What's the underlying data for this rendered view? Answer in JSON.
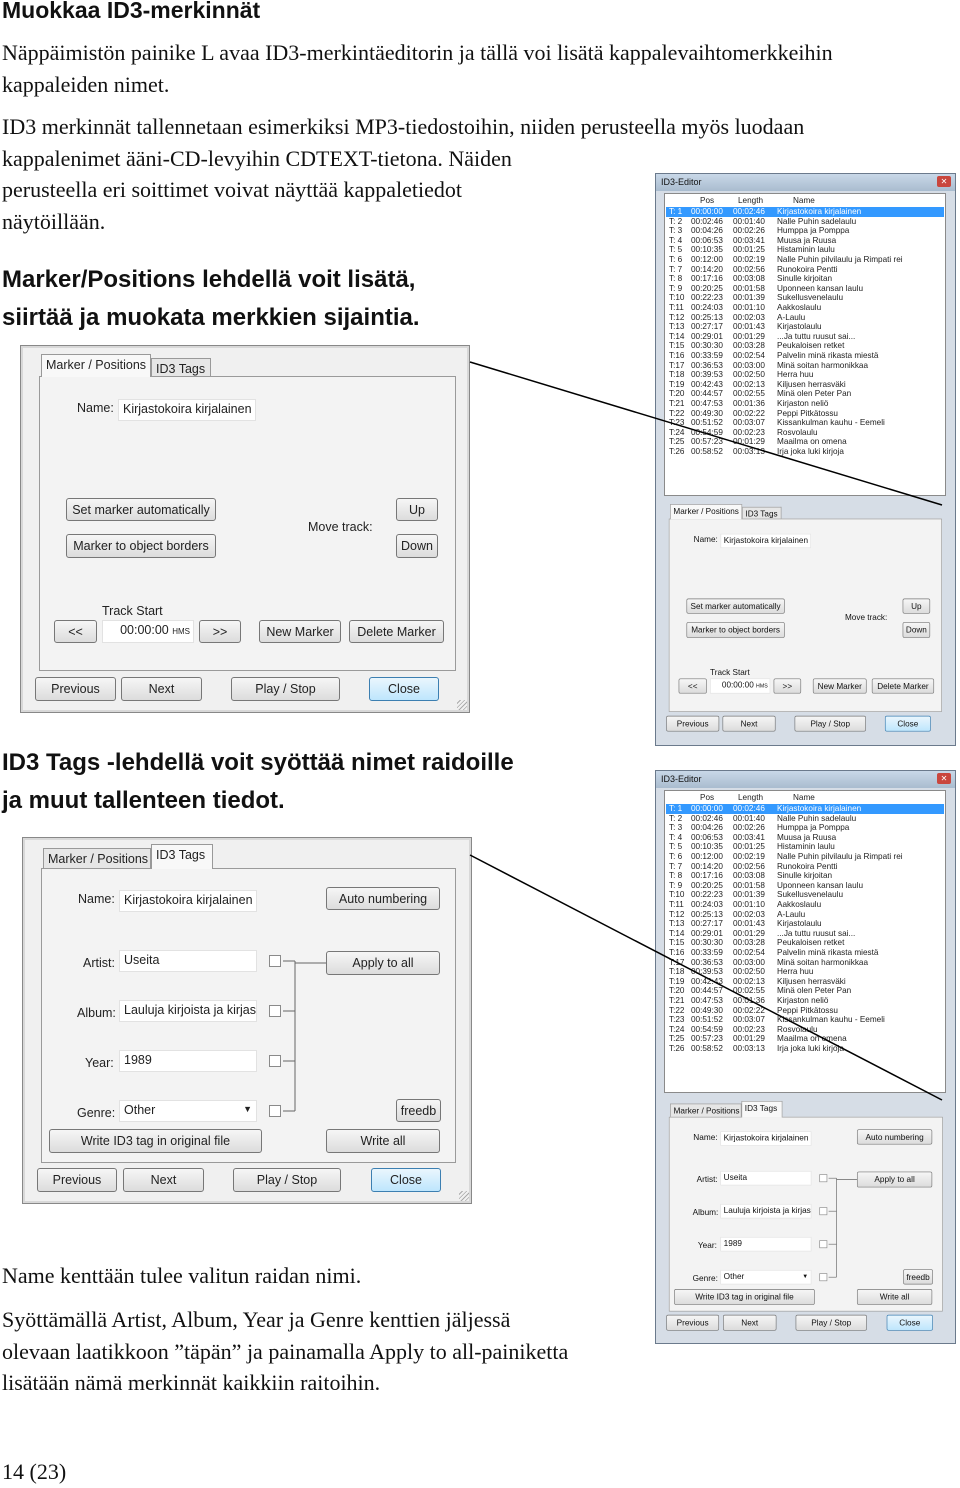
{
  "title": "Muokkaa ID3-merkinnät",
  "para1": [
    "Näppäimistön painike L avaa ID3-merkintäeditorin ja tällä voi lisätä kappalevaihtomerkkeihin",
    "kappaleiden nimet."
  ],
  "para2": [
    "ID3 merkinnät tallennetaan esimerkiksi MP3-tiedostoihin, niiden perusteella myös luodaan",
    "kappalenimet ääni-CD-levyihin CDTEXT-tietona. Näiden",
    "perusteella eri soittimet voivat näyttää kappaletiedot",
    "näytöillään."
  ],
  "heading_marker": [
    "Marker/Positions lehdellä voit lisätä,",
    "siirtää ja muokata merkkien sijaintia."
  ],
  "heading_id3": [
    "ID3 Tags -lehdellä voit syöttää nimet raidoille",
    "ja muut tallenteen tiedot."
  ],
  "para3": "Name kenttään tulee valitun raidan nimi.",
  "para4": [
    "Syöttämällä Artist, Album, Year ja Genre kenttien jäljessä",
    "olevaan laatikkoon ”täpän” ja painamalla Apply to all-painiketta",
    "lisätään nämä merkinnät kaikkiin raitoihin."
  ],
  "footer": "14 (23)",
  "editor": {
    "window_title": "ID3-Editor",
    "columns": {
      "pos": "Pos",
      "length": "Length",
      "name": "Name"
    },
    "selected_track": 1,
    "tracks": [
      {
        "num": "T: 1",
        "pos": "00:00:00",
        "len": "00:02:46",
        "name": "Kirjastokoira kirjalainen"
      },
      {
        "num": "T: 2",
        "pos": "00:02:46",
        "len": "00:01:40",
        "name": "Nalle Puhin sadelaulu"
      },
      {
        "num": "T: 3",
        "pos": "00:04:26",
        "len": "00:02:26",
        "name": "Humppa ja Pomppa"
      },
      {
        "num": "T: 4",
        "pos": "00:06:53",
        "len": "00:03:41",
        "name": "Muusa ja Ruusa"
      },
      {
        "num": "T: 5",
        "pos": "00:10:35",
        "len": "00:01:25",
        "name": "Histaminin laulu"
      },
      {
        "num": "T: 6",
        "pos": "00:12:00",
        "len": "00:02:19",
        "name": "Nalle Puhin pilvilaulu ja Rimpati rei"
      },
      {
        "num": "T: 7",
        "pos": "00:14:20",
        "len": "00:02:56",
        "name": "Runokoira Pentti"
      },
      {
        "num": "T: 8",
        "pos": "00:17:16",
        "len": "00:03:08",
        "name": "Sinulle kirjoitan"
      },
      {
        "num": "T: 9",
        "pos": "00:20:25",
        "len": "00:01:58",
        "name": "Uponneen kansan laulu"
      },
      {
        "num": "T:10",
        "pos": "00:22:23",
        "len": "00:01:39",
        "name": "Sukellusvenelaulu"
      },
      {
        "num": "T:11",
        "pos": "00:24:03",
        "len": "00:01:10",
        "name": "Aakkoslaulu"
      },
      {
        "num": "T:12",
        "pos": "00:25:13",
        "len": "00:02:03",
        "name": "A-Laulu"
      },
      {
        "num": "T:13",
        "pos": "00:27:17",
        "len": "00:01:43",
        "name": "Kirjastolaulu"
      },
      {
        "num": "T:14",
        "pos": "00:29:01",
        "len": "00:01:29",
        "name": "...Ja tuttu ruusut sai..."
      },
      {
        "num": "T:15",
        "pos": "00:30:30",
        "len": "00:03:28",
        "name": "Peukaloisen retket"
      },
      {
        "num": "T:16",
        "pos": "00:33:59",
        "len": "00:02:54",
        "name": "Palvelin minä rikasta miestä"
      },
      {
        "num": "T:17",
        "pos": "00:36:53",
        "len": "00:03:00",
        "name": "Minä soitan harmonikkaa"
      },
      {
        "num": "T:18",
        "pos": "00:39:53",
        "len": "00:02:50",
        "name": "Herra huu"
      },
      {
        "num": "T:19",
        "pos": "00:42:43",
        "len": "00:02:13",
        "name": "Kiljusen herrasväki"
      },
      {
        "num": "T:20",
        "pos": "00:44:57",
        "len": "00:02:55",
        "name": "Minä olen Peter Pan"
      },
      {
        "num": "T:21",
        "pos": "00:47:53",
        "len": "00:01:36",
        "name": "Kirjaston neliö"
      },
      {
        "num": "T:22",
        "pos": "00:49:30",
        "len": "00:02:22",
        "name": "Peppi Pitkätossu"
      },
      {
        "num": "T:23",
        "pos": "00:51:52",
        "len": "00:03:07",
        "name": "Kissankulman kauhu - Eemeli"
      },
      {
        "num": "T:24",
        "pos": "00:54:59",
        "len": "00:02:23",
        "name": "Rosvolaulu"
      },
      {
        "num": "T:25",
        "pos": "00:57:23",
        "len": "00:01:29",
        "name": "Maailma on omena"
      },
      {
        "num": "T:26",
        "pos": "00:58:52",
        "len": "00:03:13",
        "name": "Irja joka luki kirjoja"
      }
    ],
    "tabs": {
      "marker": "Marker / Positions",
      "id3": "ID3 Tags"
    },
    "marker": {
      "name_label": "Name:",
      "name_value": "Kirjastokoira kirjalainen",
      "set_auto": "Set marker automatically",
      "to_borders": "Marker to object borders",
      "move_track": "Move track:",
      "up": "Up",
      "down": "Down",
      "track_start": "Track Start",
      "prev_marker": "<<",
      "next_marker": ">>",
      "time": "00:00:00",
      "time_unit": "HMS",
      "new_marker": "New Marker",
      "delete_marker": "Delete Marker"
    },
    "id3": {
      "name_label": "Name:",
      "name_value": "Kirjastokoira kirjalainen",
      "auto_numbering": "Auto numbering",
      "artist_label": "Artist:",
      "artist_value": "Useita",
      "album_label": "Album:",
      "album_value": "Lauluja kirjoista ja kirjasto",
      "year_label": "Year:",
      "year_value": "1989",
      "genre_label": "Genre:",
      "genre_value": "Other",
      "apply_all": "Apply to all",
      "freedb": "freedb",
      "write_original": "Write ID3 tag in original file",
      "write_all": "Write all"
    },
    "bottom": {
      "previous": "Previous",
      "next": "Next",
      "play_stop": "Play / Stop",
      "close": "Close"
    }
  }
}
